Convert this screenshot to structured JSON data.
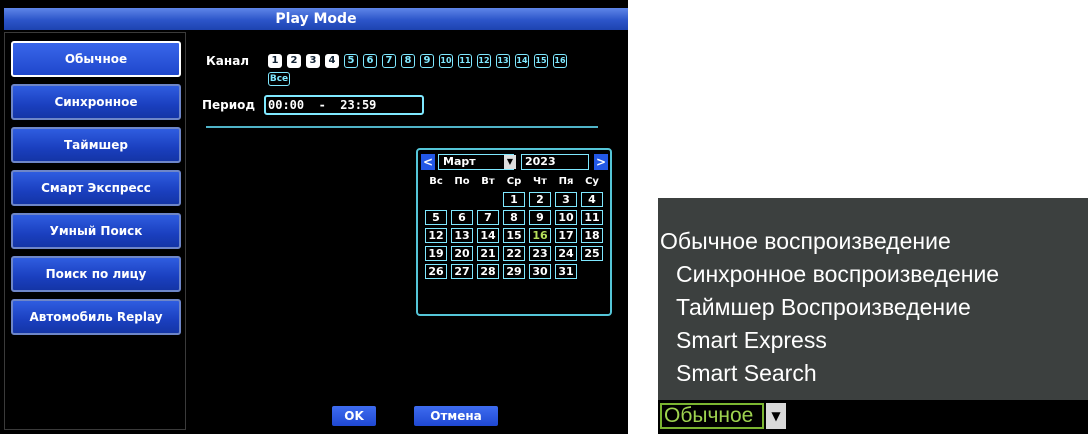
{
  "window": {
    "title": "Play Mode"
  },
  "sidebar": {
    "items": [
      {
        "label": "Обычное",
        "active": true
      },
      {
        "label": "Синхронное",
        "active": false
      },
      {
        "label": "Таймшер",
        "active": false
      },
      {
        "label": "Смарт Экспресс",
        "active": false
      },
      {
        "label": "Умный Поиск",
        "active": false
      },
      {
        "label": "Поиск по лицу",
        "active": false
      },
      {
        "label": "Автомобиль Replay",
        "active": false
      }
    ]
  },
  "channel": {
    "label": "Канал",
    "channels": [
      "1",
      "2",
      "3",
      "4",
      "5",
      "6",
      "7",
      "8",
      "9",
      "10",
      "11",
      "12",
      "13",
      "14",
      "15",
      "16"
    ],
    "selected": [
      "1",
      "2",
      "3",
      "4"
    ],
    "all_label": "Все"
  },
  "period": {
    "label": "Период",
    "start": "00:00",
    "separator": "-",
    "end": "23:59"
  },
  "calendar": {
    "month": "Март",
    "year": "2023",
    "prev": "<",
    "next": ">",
    "weekdays": [
      "Вс",
      "По",
      "Вт",
      "Ср",
      "Чт",
      "Пя",
      "Су"
    ],
    "start_weekday_index": 3,
    "days_in_month": 31,
    "highlighted_day": 16
  },
  "footer": {
    "ok_label": "OK",
    "cancel_label": "Отмена"
  },
  "dropdown": {
    "options": [
      "Обычное воспроизведение",
      "Синхронное воспроизведение",
      "Таймшер Воспроизведение",
      "Smart Express",
      "Smart Search"
    ],
    "selected_label": "Обычное"
  },
  "colors": {
    "accent_blue": "#1a3fbf",
    "outline_cyan": "#7fe8ff",
    "highlight_green": "#b6e05a"
  }
}
